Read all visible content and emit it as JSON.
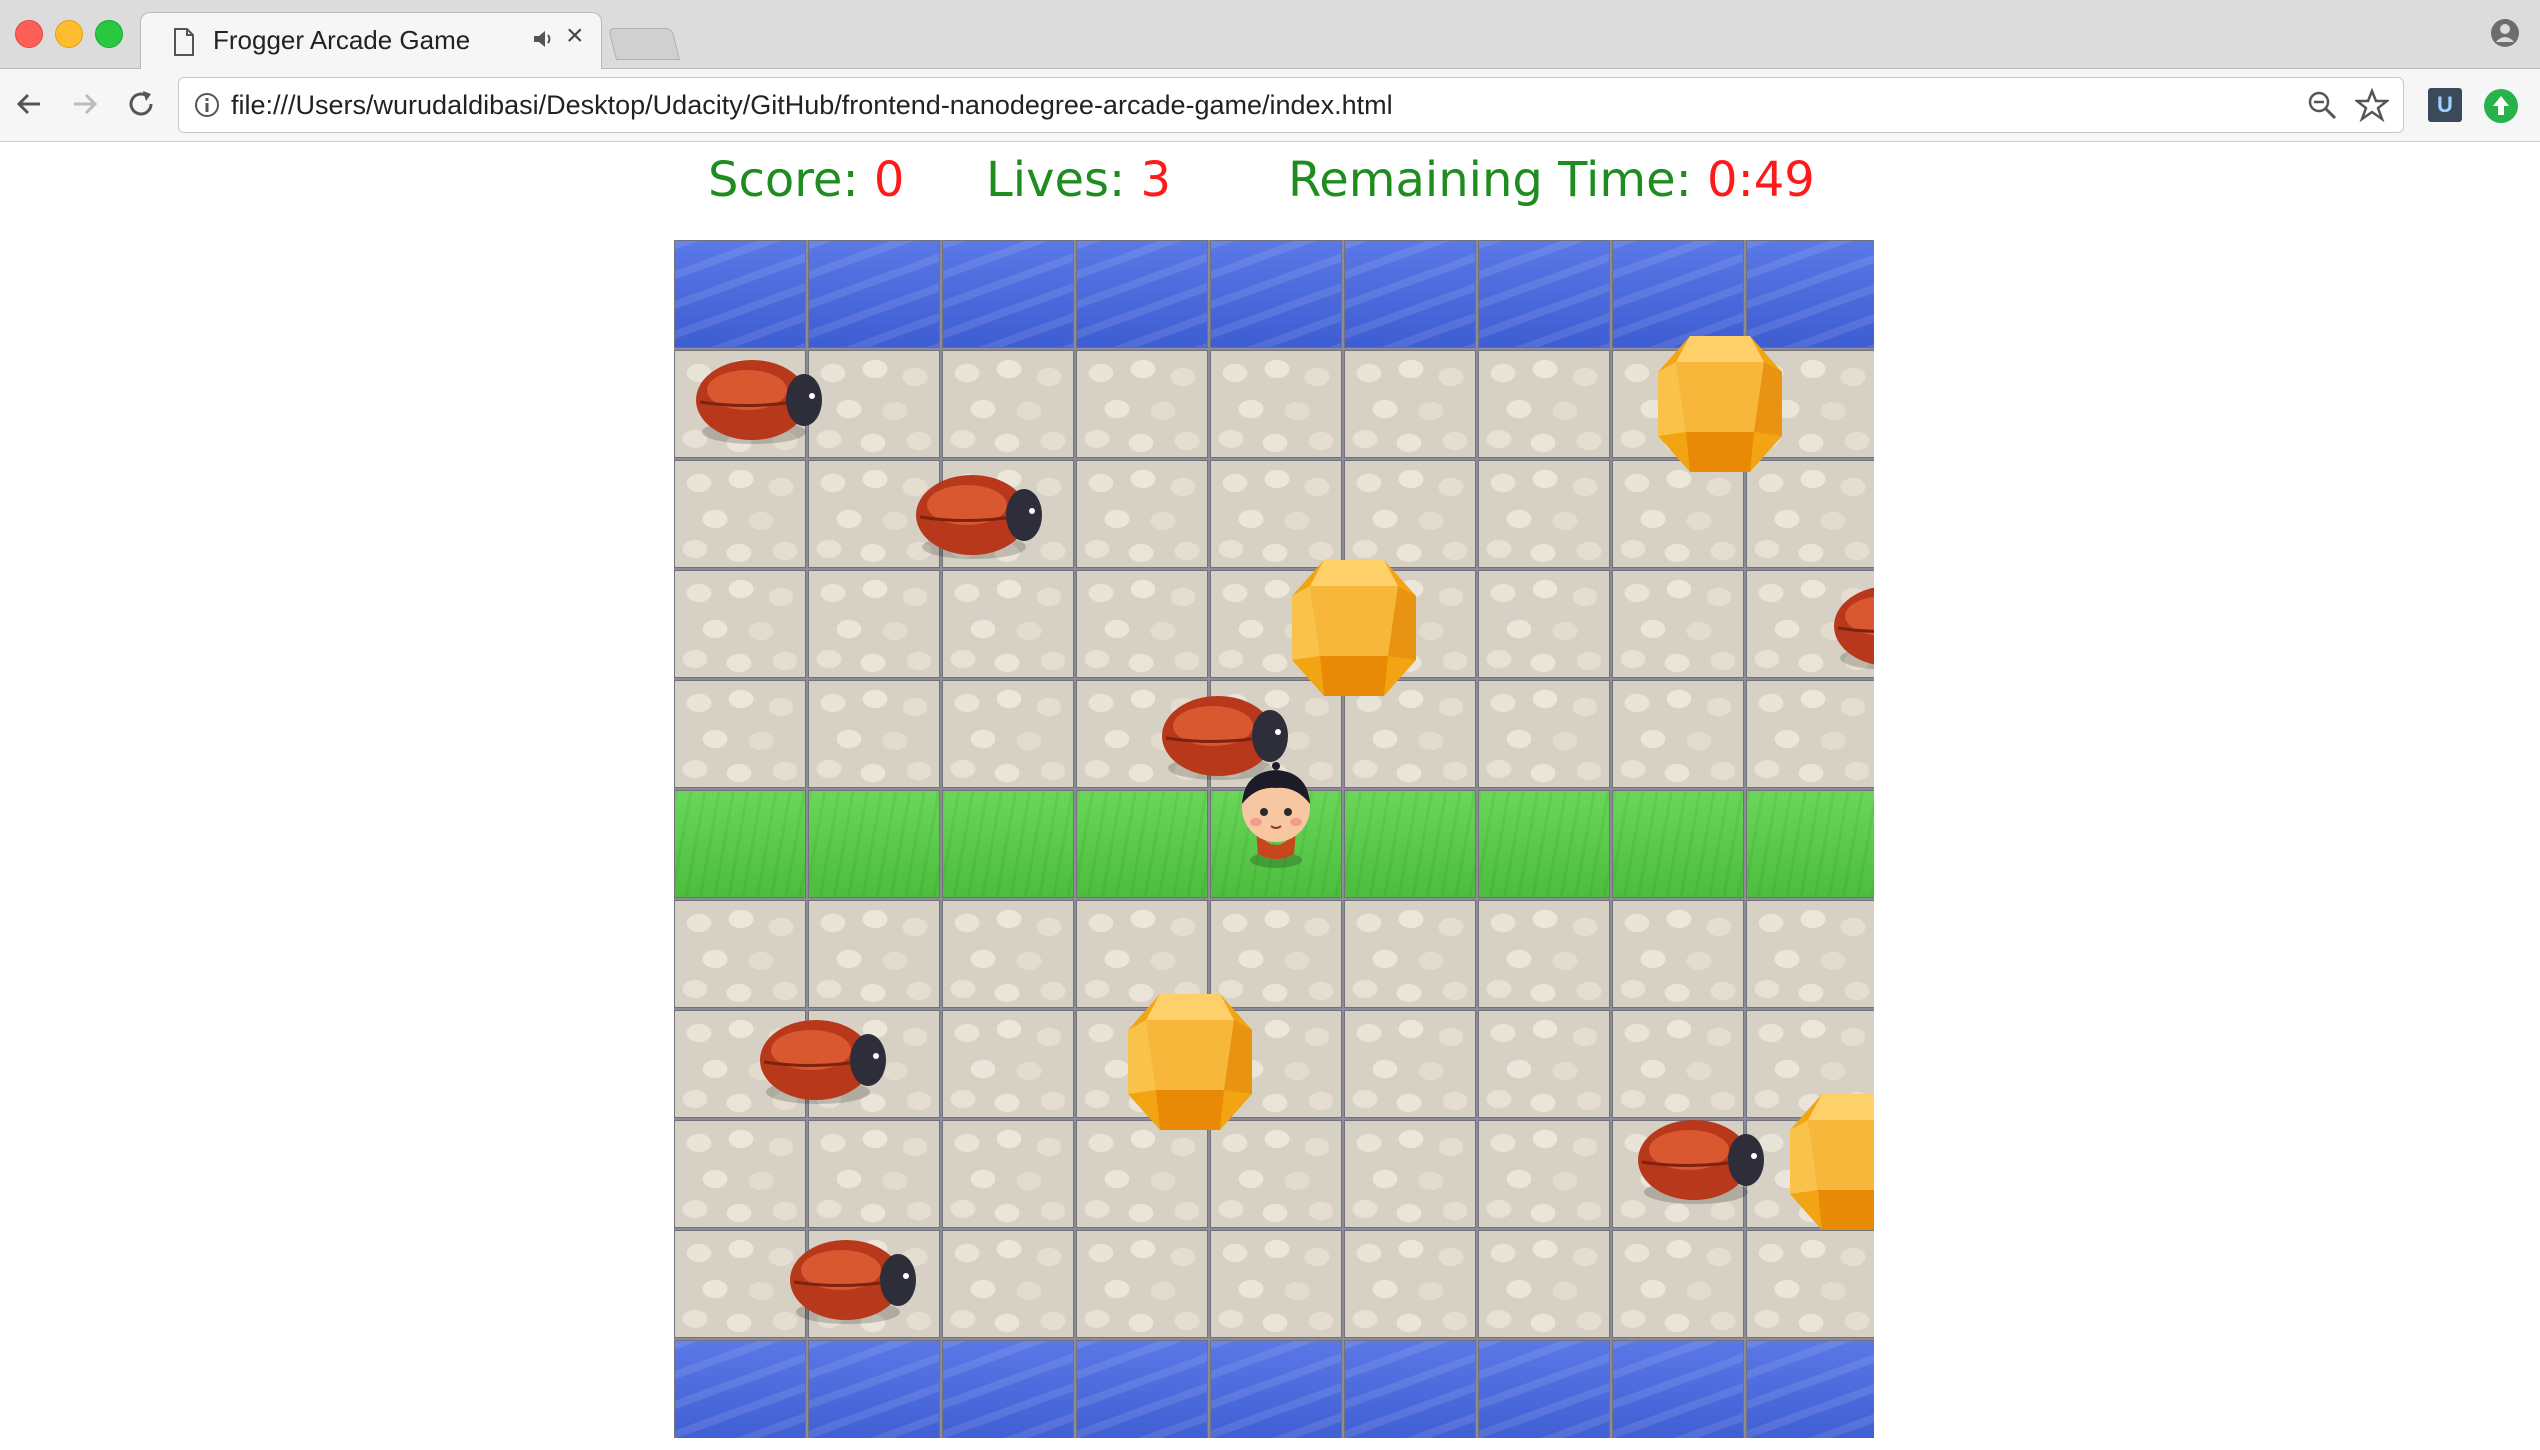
{
  "browser": {
    "tab_title": "Frogger Arcade Game",
    "tab_close_glyph": "×",
    "url": "file:///Users/wurudaldibasi/Desktop/Udacity/GitHub/frontend-nanodegree-arcade-game/index.html",
    "extension_u_label": "U",
    "icons": [
      "page-icon",
      "audio-icon",
      "close-icon",
      "profile-icon",
      "back-icon",
      "forward-icon",
      "reload-icon",
      "info-icon",
      "zoom-icon",
      "star-icon",
      "udacity-extension-icon",
      "update-icon"
    ]
  },
  "hud": {
    "score_label": "Score:",
    "score_value": "0",
    "lives_label": "Lives:",
    "lives_value": "3",
    "time_label": "Remaining Time:",
    "time_value": "0:49"
  },
  "game": {
    "rows": [
      "water",
      "stone",
      "stone",
      "stone",
      "stone",
      "grass",
      "stone",
      "stone",
      "stone",
      "stone",
      "water"
    ],
    "columns": 9,
    "colors": {
      "label": "#1e8c1e",
      "value": "#ff1a1a",
      "water": "#4a6ae0",
      "grass": "#5ccb4b",
      "stone": "#d7d1c5"
    }
  }
}
